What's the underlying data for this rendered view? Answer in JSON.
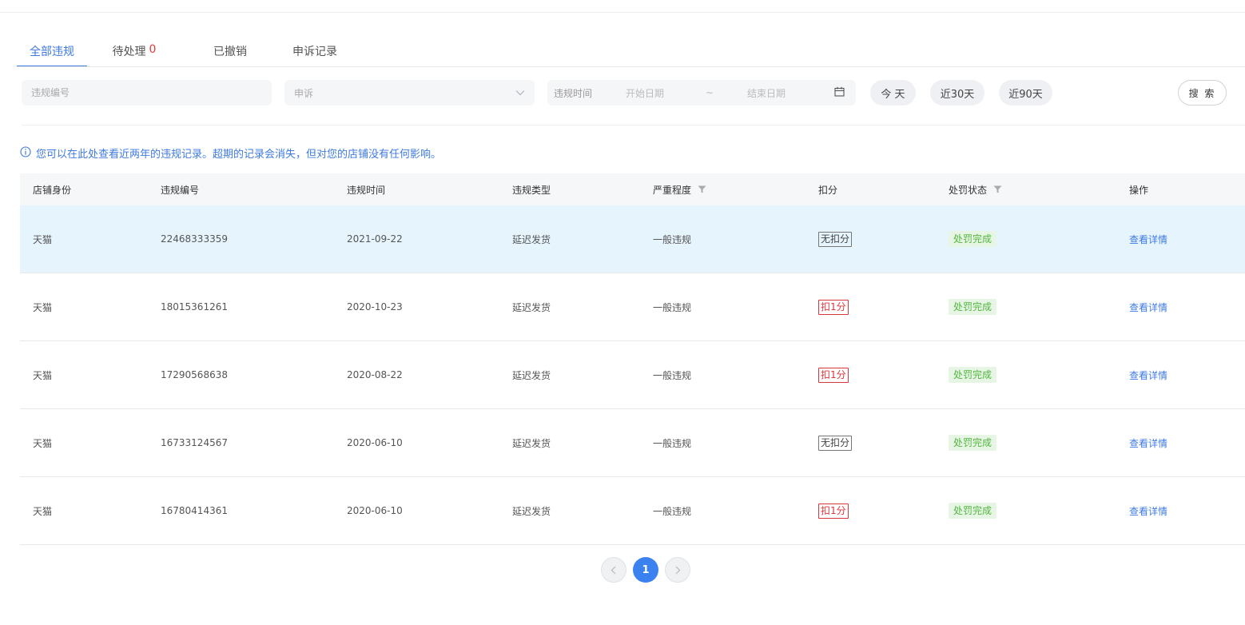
{
  "tabs": [
    {
      "label": "全部违规",
      "count": ""
    },
    {
      "label": "待处理",
      "count": "0"
    },
    {
      "label": "已撤销",
      "count": ""
    },
    {
      "label": "申诉记录",
      "count": ""
    }
  ],
  "filters": {
    "code_placeholder": "违规编号",
    "appeal_value": "申诉",
    "date_label": "违规时间",
    "start_placeholder": "开始日期",
    "separator": "~",
    "end_placeholder": "结束日期",
    "today": "今 天",
    "last30": "近30天",
    "last90": "近90天",
    "search": "搜 索"
  },
  "notice": "您可以在此处查看近两年的违规记录。超期的记录会消失，但对您的店铺没有任何影响。",
  "table": {
    "headers": [
      "店铺身份",
      "违规编号",
      "违规时间",
      "违规类型",
      "严重程度",
      "扣分",
      "处罚状态",
      "操作"
    ],
    "rows": [
      {
        "shop": "天猫",
        "code": "22468333359",
        "time": "2021-09-22",
        "type": "延迟发货",
        "severity": "一般违规",
        "deduct": "无扣分",
        "deduct_kind": "none",
        "status": "处罚完成",
        "action": "查看详情"
      },
      {
        "shop": "天猫",
        "code": "18015361261",
        "time": "2020-10-23",
        "type": "延迟发货",
        "severity": "一般违规",
        "deduct": "扣1分",
        "deduct_kind": "deduct",
        "status": "处罚完成",
        "action": "查看详情"
      },
      {
        "shop": "天猫",
        "code": "17290568638",
        "time": "2020-08-22",
        "type": "延迟发货",
        "severity": "一般违规",
        "deduct": "扣1分",
        "deduct_kind": "deduct",
        "status": "处罚完成",
        "action": "查看详情"
      },
      {
        "shop": "天猫",
        "code": "16733124567",
        "time": "2020-06-10",
        "type": "延迟发货",
        "severity": "一般违规",
        "deduct": "无扣分",
        "deduct_kind": "none",
        "status": "处罚完成",
        "action": "查看详情"
      },
      {
        "shop": "天猫",
        "code": "16780414361",
        "time": "2020-06-10",
        "type": "延迟发货",
        "severity": "一般违规",
        "deduct": "扣1分",
        "deduct_kind": "deduct",
        "status": "处罚完成",
        "action": "查看详情"
      }
    ]
  },
  "pagination": {
    "current": "1"
  },
  "colors": {
    "accent": "#3e7ae0",
    "danger": "#d9363e",
    "success": "#52b640",
    "highlight_row": "#e6f4fd"
  }
}
